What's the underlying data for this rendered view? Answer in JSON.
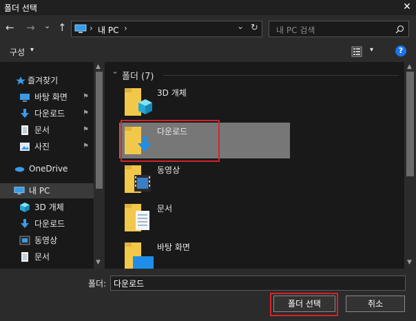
{
  "window": {
    "title": "폴더 선택",
    "close_glyph": "✕"
  },
  "nav": {
    "back_glyph": "←",
    "forward_glyph": "→",
    "recent_glyph": "⌄",
    "up_glyph": "↑",
    "address_location": "내 PC",
    "address_separator": "›",
    "dropdown_glyph": "⌄",
    "refresh_glyph": "↻",
    "search_placeholder": "내 PC 검색"
  },
  "toolbar": {
    "organize_label": "구성",
    "organize_arrow": "▾",
    "view_arrow": "▾",
    "help_glyph": "?"
  },
  "sidebar": {
    "items": [
      {
        "label": "즐겨찾기",
        "icon": "star-icon"
      },
      {
        "label": "바탕 화면",
        "icon": "desktop-icon",
        "pinned": true
      },
      {
        "label": "다운로드",
        "icon": "download-icon",
        "pinned": true
      },
      {
        "label": "문서",
        "icon": "document-icon",
        "pinned": true
      },
      {
        "label": "사진",
        "icon": "picture-icon",
        "pinned": true
      },
      {
        "label": "OneDrive",
        "icon": "cloud-icon"
      },
      {
        "label": "내 PC",
        "icon": "computer-icon",
        "selected": true
      },
      {
        "label": "3D 개체",
        "icon": "cube-icon"
      },
      {
        "label": "다운로드",
        "icon": "download-icon"
      },
      {
        "label": "동영상",
        "icon": "video-icon"
      },
      {
        "label": "문서",
        "icon": "document-icon"
      }
    ],
    "pin_glyph": "📌"
  },
  "content": {
    "group_header": "폴더 (7)",
    "group_chevron": "⌄",
    "folders": [
      {
        "label": "3D 개체",
        "icon": "cube-icon"
      },
      {
        "label": "다운로드",
        "icon": "download-icon",
        "selected": true
      },
      {
        "label": "동영상",
        "icon": "video-icon"
      },
      {
        "label": "문서",
        "icon": "document-icon"
      },
      {
        "label": "바탕 화면",
        "icon": "desktop-icon"
      }
    ]
  },
  "bottom": {
    "folder_label": "폴더:",
    "folder_value": "다운로드",
    "select_button": "폴더 선택",
    "cancel_button": "취소"
  },
  "colors": {
    "accent": "#0078d7",
    "highlight": "#d8222a",
    "folder": "#f2c84b"
  }
}
